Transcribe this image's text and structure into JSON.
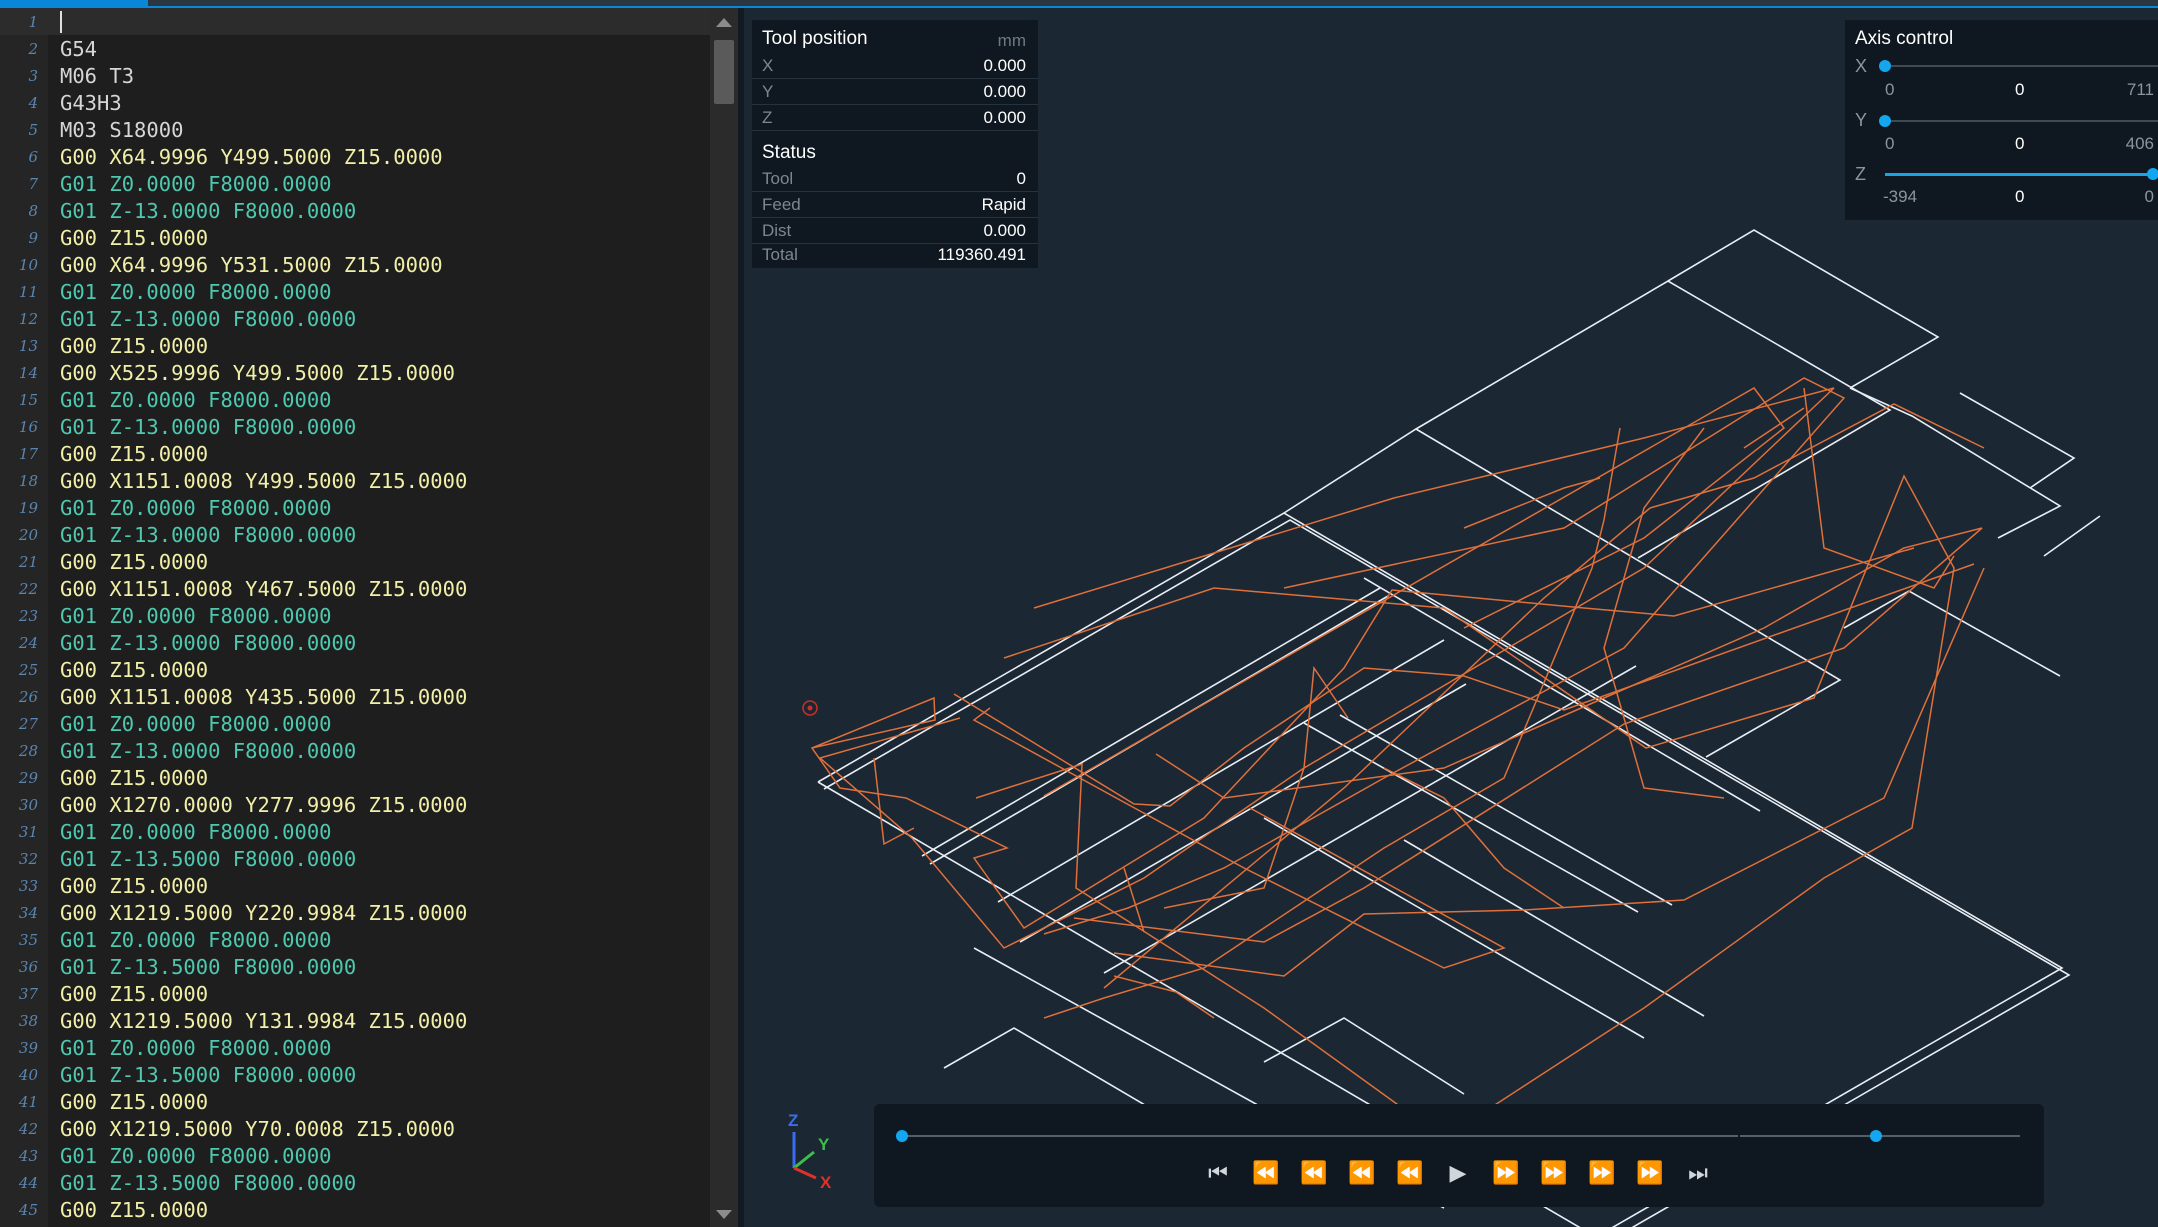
{
  "editor": {
    "lines": [
      {
        "n": "1",
        "code": "",
        "color": "w"
      },
      {
        "n": "2",
        "code": "G54",
        "color": "w"
      },
      {
        "n": "3",
        "code": "M06 T3",
        "color": "w"
      },
      {
        "n": "4",
        "code": "G43H3",
        "color": "w"
      },
      {
        "n": "5",
        "code": "M03 S18000",
        "color": "w"
      },
      {
        "n": "6",
        "code": "G00 X64.9996 Y499.5000 Z15.0000",
        "color": "y"
      },
      {
        "n": "7",
        "code": "G01 Z0.0000 F8000.0000",
        "color": "g"
      },
      {
        "n": "8",
        "code": "G01 Z-13.0000 F8000.0000",
        "color": "g"
      },
      {
        "n": "9",
        "code": "G00 Z15.0000",
        "color": "y"
      },
      {
        "n": "10",
        "code": "G00 X64.9996 Y531.5000 Z15.0000",
        "color": "y"
      },
      {
        "n": "11",
        "code": "G01 Z0.0000 F8000.0000",
        "color": "g"
      },
      {
        "n": "12",
        "code": "G01 Z-13.0000 F8000.0000",
        "color": "g"
      },
      {
        "n": "13",
        "code": "G00 Z15.0000",
        "color": "y"
      },
      {
        "n": "14",
        "code": "G00 X525.9996 Y499.5000 Z15.0000",
        "color": "y"
      },
      {
        "n": "15",
        "code": "G01 Z0.0000 F8000.0000",
        "color": "g"
      },
      {
        "n": "16",
        "code": "G01 Z-13.0000 F8000.0000",
        "color": "g"
      },
      {
        "n": "17",
        "code": "G00 Z15.0000",
        "color": "y"
      },
      {
        "n": "18",
        "code": "G00 X1151.0008 Y499.5000 Z15.0000",
        "color": "y"
      },
      {
        "n": "19",
        "code": "G01 Z0.0000 F8000.0000",
        "color": "g"
      },
      {
        "n": "20",
        "code": "G01 Z-13.0000 F8000.0000",
        "color": "g"
      },
      {
        "n": "21",
        "code": "G00 Z15.0000",
        "color": "y"
      },
      {
        "n": "22",
        "code": "G00 X1151.0008 Y467.5000 Z15.0000",
        "color": "y"
      },
      {
        "n": "23",
        "code": "G01 Z0.0000 F8000.0000",
        "color": "g"
      },
      {
        "n": "24",
        "code": "G01 Z-13.0000 F8000.0000",
        "color": "g"
      },
      {
        "n": "25",
        "code": "G00 Z15.0000",
        "color": "y"
      },
      {
        "n": "26",
        "code": "G00 X1151.0008 Y435.5000 Z15.0000",
        "color": "y"
      },
      {
        "n": "27",
        "code": "G01 Z0.0000 F8000.0000",
        "color": "g"
      },
      {
        "n": "28",
        "code": "G01 Z-13.0000 F8000.0000",
        "color": "g"
      },
      {
        "n": "29",
        "code": "G00 Z15.0000",
        "color": "y"
      },
      {
        "n": "30",
        "code": "G00 X1270.0000 Y277.9996 Z15.0000",
        "color": "y"
      },
      {
        "n": "31",
        "code": "G01 Z0.0000 F8000.0000",
        "color": "g"
      },
      {
        "n": "32",
        "code": "G01 Z-13.5000 F8000.0000",
        "color": "g"
      },
      {
        "n": "33",
        "code": "G00 Z15.0000",
        "color": "y"
      },
      {
        "n": "34",
        "code": "G00 X1219.5000 Y220.9984 Z15.0000",
        "color": "y"
      },
      {
        "n": "35",
        "code": "G01 Z0.0000 F8000.0000",
        "color": "g"
      },
      {
        "n": "36",
        "code": "G01 Z-13.5000 F8000.0000",
        "color": "g"
      },
      {
        "n": "37",
        "code": "G00 Z15.0000",
        "color": "y"
      },
      {
        "n": "38",
        "code": "G00 X1219.5000 Y131.9984 Z15.0000",
        "color": "y"
      },
      {
        "n": "39",
        "code": "G01 Z0.0000 F8000.0000",
        "color": "g"
      },
      {
        "n": "40",
        "code": "G01 Z-13.5000 F8000.0000",
        "color": "g"
      },
      {
        "n": "41",
        "code": "G00 Z15.0000",
        "color": "y"
      },
      {
        "n": "42",
        "code": "G00 X1219.5000 Y70.0008 Z15.0000",
        "color": "y"
      },
      {
        "n": "43",
        "code": "G01 Z0.0000 F8000.0000",
        "color": "g"
      },
      {
        "n": "44",
        "code": "G01 Z-13.5000 F8000.0000",
        "color": "g"
      },
      {
        "n": "45",
        "code": "G00 Z15.0000",
        "color": "y"
      }
    ]
  },
  "tool_position": {
    "title": "Tool position",
    "unit": "mm",
    "x_label": "X",
    "x_value": "0.000",
    "y_label": "Y",
    "y_value": "0.000",
    "z_label": "Z",
    "z_value": "0.000"
  },
  "status": {
    "title": "Status",
    "tool_label": "Tool",
    "tool_value": "0",
    "feed_label": "Feed",
    "feed_value": "Rapid",
    "dist_label": "Dist",
    "dist_value": "0.000",
    "total_label": "Total",
    "total_value": "119360.491"
  },
  "axis_control": {
    "title": "Axis control",
    "x": {
      "label": "X",
      "min": "0",
      "value": "0",
      "max": "711",
      "fraction": 0.0
    },
    "y": {
      "label": "Y",
      "min": "0",
      "value": "0",
      "max": "406",
      "fraction": 0.0
    },
    "z": {
      "label": "Z",
      "min": "-394",
      "value": "0",
      "max": "0",
      "fraction": 1.0
    }
  },
  "gizmo": {
    "z": "Z",
    "y": "Y",
    "x": "X"
  },
  "playback": {
    "progress_fraction": 0.0,
    "speed_fraction": 0.5
  },
  "colors": {
    "accent": "#13a7f0",
    "toolpath": "#e0703a",
    "part_outline": "#e8eef4",
    "rapid": "#f2f0a8",
    "feed": "#4ec9b0"
  }
}
